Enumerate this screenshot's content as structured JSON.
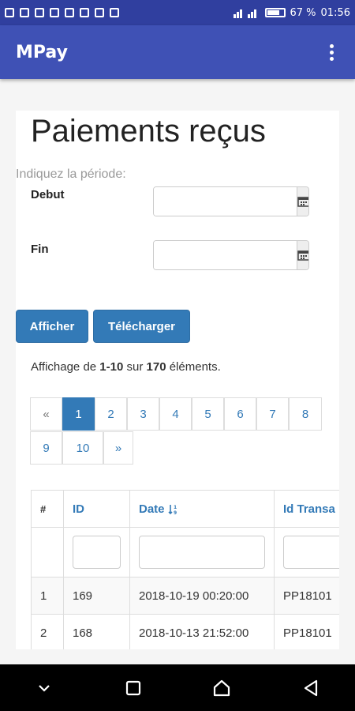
{
  "status_bar": {
    "battery": "67 %",
    "time": "01:56"
  },
  "app_bar": {
    "title": "MPay",
    "overflow_icon": "more-vert-icon"
  },
  "page": {
    "title": "Paiements reçus",
    "period_label": "Indiquez la période:",
    "start_label": "Debut",
    "start_value": "",
    "end_label": "Fin",
    "end_value": "",
    "calendar_icon": "calendar-icon"
  },
  "actions": {
    "show_label": "Afficher",
    "download_label": "Télécharger"
  },
  "summary": {
    "prefix": "Affichage de",
    "range": "1-10",
    "middle": "sur",
    "total": "170",
    "suffix": "éléments."
  },
  "pagination": {
    "prev": "«",
    "next": "»",
    "current": "1",
    "pages": [
      "1",
      "2",
      "3",
      "4",
      "5",
      "6",
      "7",
      "8",
      "9",
      "10"
    ]
  },
  "table": {
    "headers": [
      "#",
      "ID",
      "Date",
      "Id Transa"
    ],
    "sorted_column": "Date",
    "rows": [
      [
        "1",
        "169",
        "2018-10-19 00:20:00",
        "PP18101"
      ],
      [
        "2",
        "168",
        "2018-10-13 21:52:00",
        "PP18101"
      ]
    ]
  },
  "nav_bar": {
    "icons": [
      "chevron-down-icon",
      "recents-square-icon",
      "home-icon",
      "back-triangle-icon"
    ]
  }
}
